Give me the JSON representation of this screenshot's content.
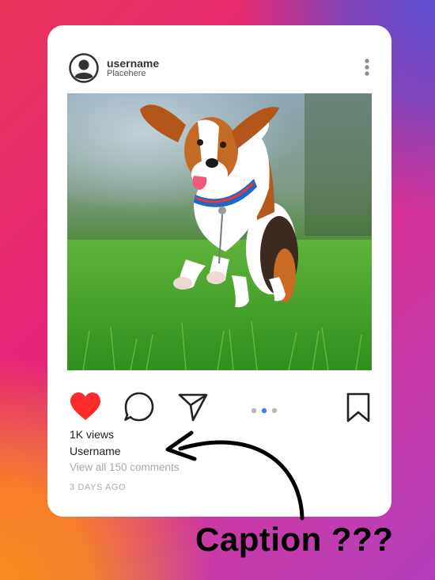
{
  "post": {
    "username": "username",
    "location": "Placehere",
    "views": "1K views",
    "caption_username": "Username",
    "view_comments": "View all 150 comments",
    "time_ago": "3 DAYS AGO",
    "carousel": {
      "count": 3,
      "active_index": 1
    },
    "liked": true
  },
  "overlay": {
    "annotation": "Caption ???"
  },
  "colors": {
    "heart": "#ff2a2a",
    "active_dot": "#3b82f6",
    "inactive_dot": "#b8b8b8",
    "icon_stroke": "#222222"
  },
  "icons": [
    "avatar-icon",
    "more-vertical-icon",
    "heart-icon",
    "comment-icon",
    "share-icon",
    "bookmark-icon",
    "arrow-icon"
  ]
}
